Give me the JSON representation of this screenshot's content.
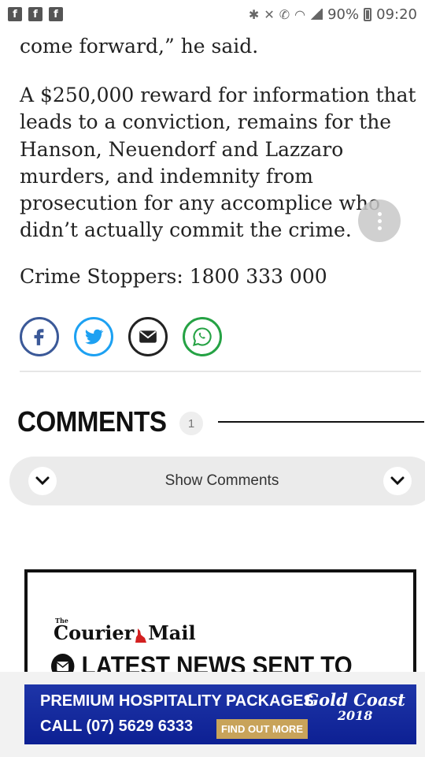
{
  "status_bar": {
    "app_icons": [
      "f",
      "f",
      "f"
    ],
    "battery": "90%",
    "time": "09:20"
  },
  "article": {
    "cut_paragraph_end": "come forward,” he said.",
    "paragraph": "A $250,000 reward for information that leads to a conviction, remains for the Hanson, Neuendorf and Lazzaro murders, and indemnity from prosecution for any accomplice who didn’t actually commit the crime.",
    "crime_stoppers": "Crime Stoppers: 1800 333 000"
  },
  "share": {
    "icons": [
      "facebook-icon",
      "twitter-icon",
      "email-icon",
      "whatsapp-icon"
    ],
    "colors": {
      "facebook": "#3b5998",
      "twitter": "#1da1f2",
      "email": "#222222",
      "whatsapp": "#25a244"
    }
  },
  "comments": {
    "title": "COMMENTS",
    "count": "1",
    "show_label": "Show Comments"
  },
  "newsletter": {
    "logo_small": "The",
    "logo_left": "Courier",
    "logo_right": "Mail",
    "headline": "LATEST NEWS SENT TO"
  },
  "ad": {
    "line1": "PREMIUM HOSPITALITY PACKAGES",
    "line2": "CALL (07) 5629 6333",
    "cta": "FIND OUT MORE",
    "brand": "Gold Coast",
    "brand_year": "2018"
  }
}
